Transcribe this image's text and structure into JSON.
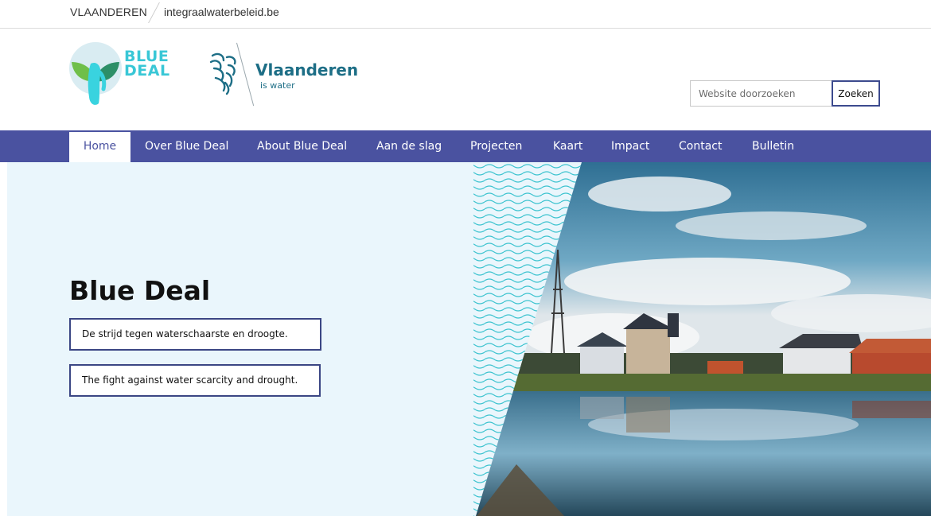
{
  "topbar": {
    "crumb_main": "VLAANDEREN",
    "crumb_site": "integraalwaterbeleid.be"
  },
  "header": {
    "bluedeal_logo_line1": "BLUE",
    "bluedeal_logo_line2": "DEAL",
    "vlaanderen_title": "Vlaanderen",
    "vlaanderen_sub": "is water",
    "search_placeholder": "Website doorzoeken",
    "search_button": "Zoeken"
  },
  "nav": {
    "items": [
      {
        "label": "Home",
        "active": true
      },
      {
        "label": "Over Blue Deal"
      },
      {
        "label": "About Blue Deal"
      },
      {
        "label": "Aan de slag"
      },
      {
        "label": "Projecten"
      },
      {
        "label": "Kaart"
      },
      {
        "label": "Impact"
      },
      {
        "label": "Contact"
      },
      {
        "label": "Bulletin"
      }
    ]
  },
  "hero": {
    "title": "Blue Deal",
    "tagline_nl": "De strijd tegen waterschaarste en droogte.",
    "tagline_en": "The fight against water scarcity and drought."
  },
  "colors": {
    "nav_bg": "#4a52a0",
    "hero_bg": "#eaf6fc",
    "bluedeal_cyan": "#39c7d6",
    "vlaanderen_teal": "#1d6e86",
    "wave_cyan": "#3cc3cf"
  },
  "icons": {
    "bluedeal_logo": "water-drop-leaf-logo",
    "vlaanderen_logo": "flemish-lion-icon"
  }
}
